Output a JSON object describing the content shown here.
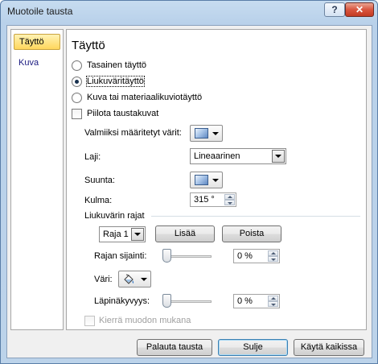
{
  "window": {
    "title": "Muotoile tausta",
    "help_label": "?",
    "close_label": "✕"
  },
  "sidebar": {
    "items": [
      {
        "label": "Täyttö",
        "active": true
      },
      {
        "label": "Kuva",
        "active": false
      }
    ]
  },
  "fill": {
    "heading": "Täyttö",
    "options": [
      {
        "label": "Tasainen täyttö",
        "selected": false
      },
      {
        "label": "Liukuväritäyttö",
        "selected": true
      },
      {
        "label": "Kuva tai materiaalikuviotäyttö",
        "selected": false
      }
    ],
    "hide_bg_label": "Piilota taustakuvat",
    "hide_bg_checked": false,
    "preset_label": "Valmiiksi määritetyt värit:",
    "type_label": "Laji:",
    "type_value": "Lineaarinen",
    "direction_label": "Suunta:",
    "angle_label": "Kulma:",
    "angle_value": "315 °",
    "stops_group_label": "Liukuvärin rajat",
    "stop_select_value": "Raja 1",
    "add_label": "Lisää",
    "remove_label": "Poista",
    "stop_position_label": "Rajan sijainti:",
    "stop_position_value": "0 %",
    "stop_position_level": 0,
    "color_label": "Väri:",
    "transparency_label": "Läpinäkyvyys:",
    "transparency_value": "0 %",
    "transparency_level": 0,
    "rotate_label": "Kierrä muodon mukana",
    "rotate_checked": false
  },
  "footer": {
    "reset_label": "Palauta tausta",
    "close_label": "Sulje",
    "apply_all_label": "Käytä kaikissa"
  },
  "colors": {
    "selected_item_bg": "#ffd65c",
    "close_button": "#c33a22"
  },
  "icons": [
    "help-icon",
    "close-icon",
    "gradient-swatch-icon",
    "paint-bucket-icon",
    "chevron-down-icon",
    "spin-up-icon",
    "spin-down-icon"
  ]
}
